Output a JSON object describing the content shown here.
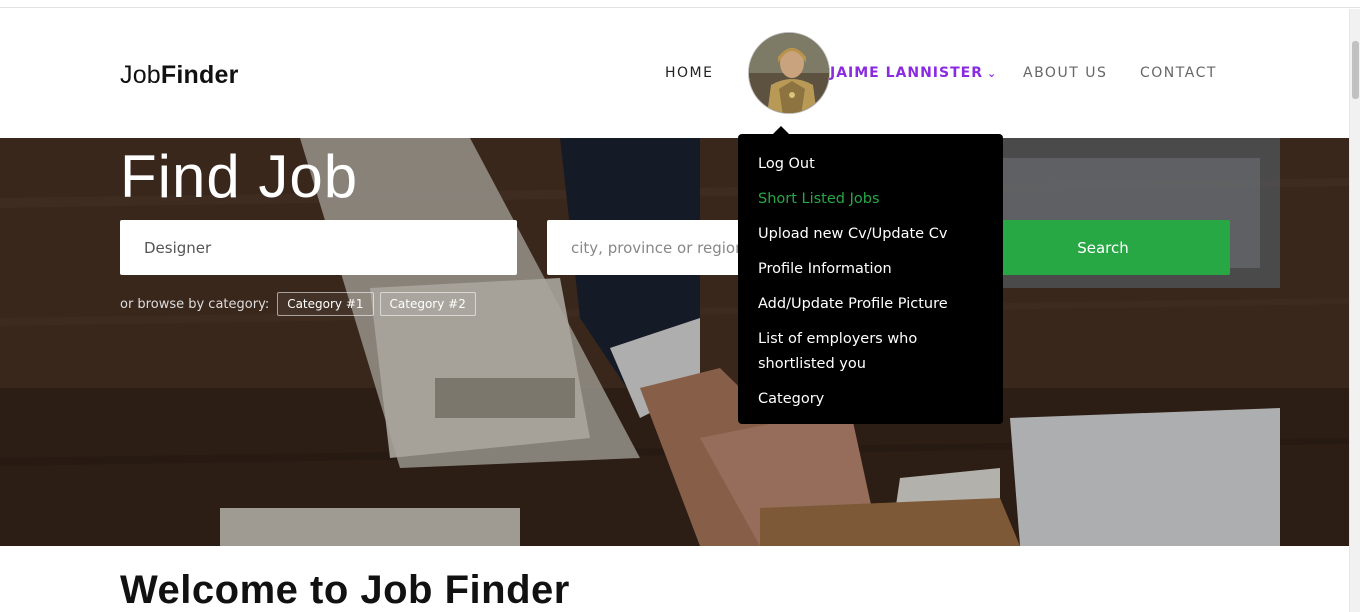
{
  "brand": {
    "light": "Job",
    "bold": "Finder"
  },
  "nav": {
    "home": "HOME",
    "user": "JAIME LANNISTER",
    "about": "ABOUT US",
    "contact": "CONTACT"
  },
  "hero": {
    "title": "Find Job",
    "keyword_value": "Designer",
    "location_placeholder": "city, province or region",
    "search_label": "Search",
    "browse_label": "or browse by category:",
    "categories": [
      "Category #1",
      "Category #2"
    ]
  },
  "user_menu": {
    "items": [
      "Log Out",
      "Short Listed Jobs",
      "Upload new Cv/Update Cv",
      "Profile Information",
      "Add/Update Profile Picture",
      "List of employers who shortlisted you",
      "Category"
    ]
  },
  "welcome": "Welcome to Job Finder",
  "colors": {
    "accent": "#28a745",
    "user_link": "#8a2be2",
    "menu_bg": "#000000"
  }
}
